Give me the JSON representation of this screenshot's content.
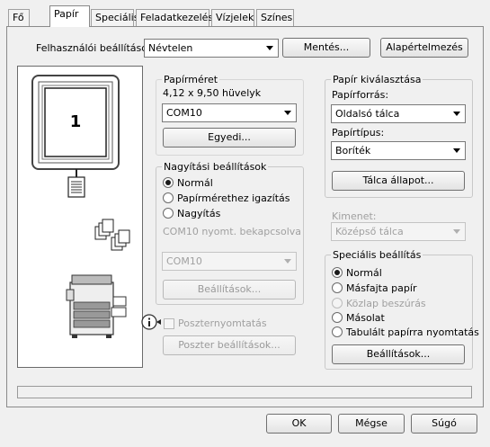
{
  "tabs": [
    {
      "label": "Fő"
    },
    {
      "label": "Papír"
    },
    {
      "label": "Speciális"
    },
    {
      "label": "Feladatkezelés"
    },
    {
      "label": "Vízjelek"
    },
    {
      "label": "Színes"
    }
  ],
  "user_settings": {
    "label": "Felhasználói beállítások:",
    "value": "Névtelen",
    "save_button": "Mentés...",
    "defaults_button": "Alapértelmezés"
  },
  "preview": {
    "page_number": "1"
  },
  "paper_size": {
    "title": "Papírméret",
    "dimensions": "4,12 x 9,50 hüvelyk",
    "value": "COM10",
    "custom_button": "Egyedi..."
  },
  "zoom": {
    "title": "Nagyítási beállítások",
    "options": [
      "Normál",
      "Papírmérethez igazítás",
      "Nagyítás"
    ],
    "selected_index": 0,
    "fit_note": "COM10 nyomt. bekapcsolva",
    "fit_size_value": "COM10",
    "settings_button": "Beállítások..."
  },
  "poster": {
    "checkbox_label": "Poszternyomtatás",
    "settings_button": "Poszter beállítások..."
  },
  "paper_selection": {
    "title": "Papír kiválasztása",
    "source_label": "Papírforrás:",
    "source_value": "Oldalsó tálca",
    "type_label": "Papírtípus:",
    "type_value": "Boríték",
    "tray_status_button": "Tálca állapot..."
  },
  "output": {
    "label": "Kimenet:",
    "value": "Középső tálca"
  },
  "special": {
    "title": "Speciális beállítás",
    "options": [
      {
        "label": "Normál",
        "state": "selected"
      },
      {
        "label": "Másfajta papír",
        "state": "normal"
      },
      {
        "label": "Közlap beszúrás",
        "state": "disabled"
      },
      {
        "label": "Másolat",
        "state": "normal"
      },
      {
        "label": "Tabulált papírra nyomtatás",
        "state": "normal"
      }
    ],
    "settings_button": "Beállítások..."
  },
  "footer": {
    "ok": "OK",
    "cancel": "Mégse",
    "help": "Súgó"
  },
  "colors": {
    "dialog_bg": "#f0f0f0",
    "border": "#8a8a8a"
  }
}
